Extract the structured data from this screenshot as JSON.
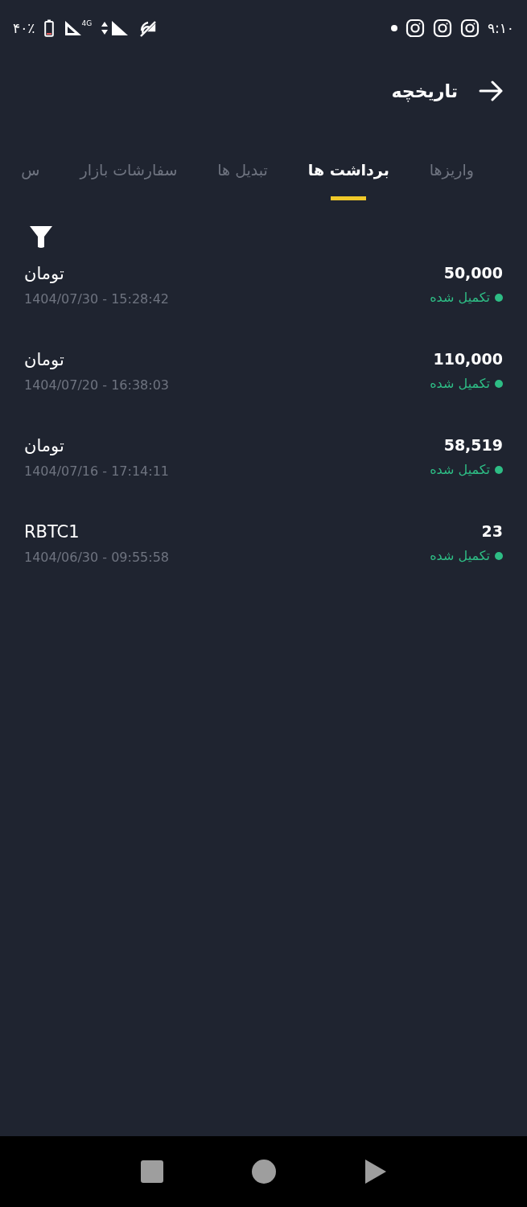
{
  "status_bar": {
    "time": "۹:۱۰",
    "battery": "۴۰٪",
    "network": "4G"
  },
  "header": {
    "title": "تاریخچه"
  },
  "tabs": [
    {
      "label": "واریزها",
      "selected": false
    },
    {
      "label": "برداشت ها",
      "selected": true
    },
    {
      "label": "تبدیل ها",
      "selected": false
    },
    {
      "label": "سفارشات بازار",
      "selected": false
    },
    {
      "label": "س",
      "selected": false
    }
  ],
  "rows": [
    {
      "amount": "50,000",
      "status": "تکمیل شده",
      "color": "#2ebd85",
      "currency": "تومان",
      "datetime": "1404/07/30 - 15:28:42"
    },
    {
      "amount": "110,000",
      "status": "تکمیل شده",
      "color": "#2ebd85",
      "currency": "تومان",
      "datetime": "1404/07/20 - 16:38:03"
    },
    {
      "amount": "58,519",
      "status": "تکمیل شده",
      "color": "#2ebd85",
      "currency": "تومان",
      "datetime": "1404/07/16 - 17:14:11"
    },
    {
      "amount": "23",
      "status": "تکمیل شده",
      "color": "#2ebd85",
      "currency": "RBTC1",
      "datetime": "1404/06/30 - 09:55:58"
    }
  ]
}
